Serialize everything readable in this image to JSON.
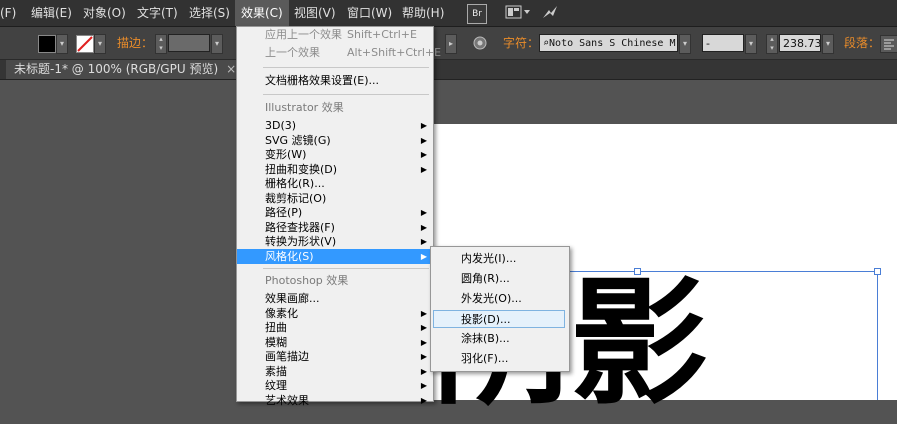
{
  "menubar": {
    "items": [
      {
        "label": "(F)"
      },
      {
        "label": "编辑(E)"
      },
      {
        "label": "对象(O)"
      },
      {
        "label": "文字(T)"
      },
      {
        "label": "选择(S)"
      },
      {
        "label": "效果(C)"
      },
      {
        "label": "视图(V)"
      },
      {
        "label": "窗口(W)"
      },
      {
        "label": "帮助(H)"
      }
    ],
    "bridge_label": "Br"
  },
  "toolbar": {
    "stroke_label": "描边：",
    "char_label": "字符：",
    "font_name": "Noto Sans S Chinese M",
    "font_size": "238.73",
    "para_label": "段落："
  },
  "document_tab": {
    "title": "未标题-1* @ 100% (RGB/GPU 预览)",
    "close": "×"
  },
  "canvas": {
    "text": "阴影"
  },
  "effect_menu": {
    "items": [
      {
        "label": "应用上一个效果",
        "shortcut": "Shift+Ctrl+E",
        "state": "disabled"
      },
      {
        "label": "上一个效果",
        "shortcut": "Alt+Shift+Ctrl+E",
        "state": "disabled"
      },
      {
        "label": "文档栅格效果设置(E)...",
        "shortcut": "",
        "state": "normal"
      },
      {
        "label": "Illustrator 效果",
        "shortcut": "",
        "state": "header"
      },
      {
        "label": "3D(3)",
        "shortcut": "",
        "state": "submenu"
      },
      {
        "label": "SVG 滤镜(G)",
        "shortcut": "",
        "state": "submenu"
      },
      {
        "label": "变形(W)",
        "shortcut": "",
        "state": "submenu"
      },
      {
        "label": "扭曲和变换(D)",
        "shortcut": "",
        "state": "submenu"
      },
      {
        "label": "栅格化(R)...",
        "shortcut": "",
        "state": "normal"
      },
      {
        "label": "裁剪标记(O)",
        "shortcut": "",
        "state": "normal"
      },
      {
        "label": "路径(P)",
        "shortcut": "",
        "state": "submenu"
      },
      {
        "label": "路径查找器(F)",
        "shortcut": "",
        "state": "submenu"
      },
      {
        "label": "转换为形状(V)",
        "shortcut": "",
        "state": "submenu"
      },
      {
        "label": "风格化(S)",
        "shortcut": "",
        "state": "highlighted"
      },
      {
        "label": "Photoshop 效果",
        "shortcut": "",
        "state": "header"
      },
      {
        "label": "效果画廊...",
        "shortcut": "",
        "state": "normal"
      },
      {
        "label": "像素化",
        "shortcut": "",
        "state": "submenu"
      },
      {
        "label": "扭曲",
        "shortcut": "",
        "state": "submenu"
      },
      {
        "label": "模糊",
        "shortcut": "",
        "state": "submenu"
      },
      {
        "label": "画笔描边",
        "shortcut": "",
        "state": "submenu"
      },
      {
        "label": "素描",
        "shortcut": "",
        "state": "submenu"
      },
      {
        "label": "纹理",
        "shortcut": "",
        "state": "submenu"
      },
      {
        "label": "艺术效果",
        "shortcut": "",
        "state": "submenu"
      }
    ]
  },
  "stylize_submenu": {
    "items": [
      {
        "label": "内发光(I)..."
      },
      {
        "label": "圆角(R)..."
      },
      {
        "label": "外发光(O)..."
      },
      {
        "label": "投影(D)..."
      },
      {
        "label": "涂抹(B)..."
      },
      {
        "label": "羽化(F)..."
      }
    ]
  }
}
